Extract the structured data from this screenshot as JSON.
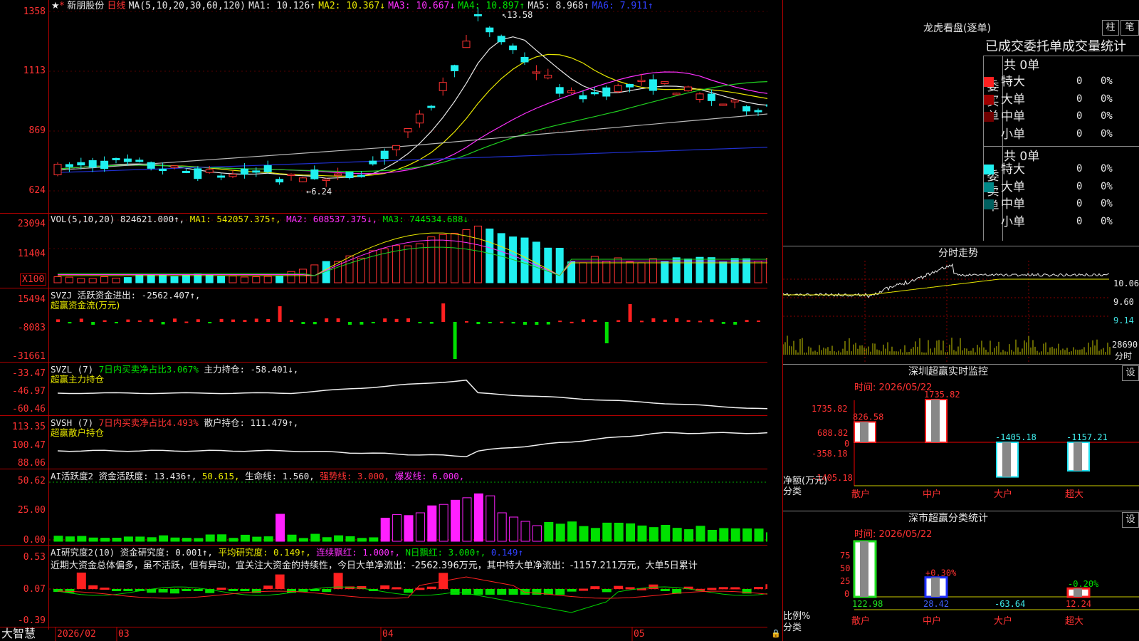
{
  "header": {
    "stock_name": "新朋股份",
    "period": "日线",
    "ma_label": "MA(5,10,20,30,60,120)",
    "ma1": "MA1: 10.126↑",
    "ma2": "MA2: 10.367↓",
    "ma3": "MA3: 10.667↓",
    "ma4": "MA4: 10.897↑",
    "ma5": "MA5: 8.968↑",
    "ma6": "MA6: 7.911↑",
    "high_mark": "13.58",
    "low_mark": "6.24"
  },
  "price_axis": [
    "1358",
    "1113",
    "869",
    "624"
  ],
  "vol": {
    "label": "VOL(5,10,20)",
    "value": "824621.000↑,",
    "ma1": "MA1: 542057.375↑,",
    "ma2": "MA2: 608537.375↓,",
    "ma3": "MA3: 744534.688↓",
    "axis": [
      "23094",
      "11404"
    ],
    "unit": "X100"
  },
  "svzj": {
    "label": "SVZJ  活跃资金进出: -2562.407↑,",
    "sub": "超赢资金流(万元)",
    "axis": [
      "15494",
      "-8083",
      "-31661"
    ]
  },
  "svzl": {
    "prefix": "SVZL (7)",
    "ratio": "7日内买卖净占比3.067%",
    "hold": "主力持仓: -58.401↓,",
    "sub": "超赢主力持仓",
    "axis": [
      "-33.47",
      "-46.97",
      "-60.46"
    ]
  },
  "svsh": {
    "prefix": "SVSH (7)",
    "ratio": "7日内买卖净占比4.493%",
    "hold": "散户持仓: 111.479↑,",
    "sub": "超赢散户持仓",
    "axis": [
      "113.35",
      "100.47",
      "88.06"
    ]
  },
  "ai_active": {
    "prefix": "AI活跃度2",
    "active": "资金活跃度: 13.436↑,",
    "v2": "50.615,",
    "life": "生命线: 1.560,",
    "strong": "强势线: 3.000,",
    "burst": "爆发线: 6.000,",
    "axis": [
      "50.62",
      "25.00",
      "0.00"
    ]
  },
  "ai_research": {
    "prefix": "AI研究度2(10)",
    "research": "资金研究度: 0.001↑,",
    "avg": "平均研究度: 0.149↑,",
    "cont": "连续飘红: 1.000↑,",
    "nday": "N日飘红: 3.000↑,",
    "last": "0.149↑",
    "comment": "近期大资金总体偏多，虽不活跃，但有异动，宜关注大资金的持续性，今日大单净流出：-2562.396万元，其中特大单净流出：-1157.211万元，大单5日累计",
    "axis": [
      "0.53",
      "0.07",
      "-0.39"
    ]
  },
  "date_axis": {
    "brand": "大智慧",
    "labels": [
      "2026/02",
      "03",
      "04",
      "05"
    ]
  },
  "dragon_tiger": {
    "title": "龙虎看盘(逐单)",
    "btn_bar": "柱",
    "btn_pen": "笔",
    "subtitle": "已成交委托单成交量统计",
    "buy_header": "共 0单",
    "buy_side": "委买单",
    "sell_header": "共 0单",
    "sell_side": "委卖单",
    "buy_rows": [
      {
        "label": "特大",
        "count": "0",
        "pct": "0%",
        "color": "#ff2020"
      },
      {
        "label": "大单",
        "count": "0",
        "pct": "0%",
        "color": "#a00000"
      },
      {
        "label": "中单",
        "count": "0",
        "pct": "0%",
        "color": "#700000"
      },
      {
        "label": "小单",
        "count": "0",
        "pct": "0%",
        "color": "#000000"
      }
    ],
    "sell_rows": [
      {
        "label": "特大",
        "count": "0",
        "pct": "0%",
        "color": "#20f0f0"
      },
      {
        "label": "大单",
        "count": "0",
        "pct": "0%",
        "color": "#008888"
      },
      {
        "label": "中单",
        "count": "0",
        "pct": "0%",
        "color": "#006060"
      },
      {
        "label": "小单",
        "count": "0",
        "pct": "0%",
        "color": "#000000"
      }
    ]
  },
  "intraday": {
    "title": "分时走势",
    "price_labels": [
      "10.06",
      "9.60",
      "9.14"
    ],
    "vol_label": "28690",
    "vol_unit": "分时"
  },
  "sz_monitor": {
    "title": "深圳超赢实时监控",
    "btn": "设",
    "time": "时间: 2026/05/22",
    "axis": [
      "1735.82",
      "688.82",
      "0",
      "-358.18",
      "-1405.18"
    ],
    "ylabel1": "净额(万元)",
    "ylabel2": "分类",
    "chart_data": {
      "type": "bar",
      "categories": [
        "散户",
        "中户",
        "大户",
        "超大"
      ],
      "values": [
        826.58,
        1735.82,
        -1405.18,
        -1157.21
      ],
      "labels": [
        "826.58",
        "1735.82",
        "-1405.18",
        "-1157.21"
      ]
    }
  },
  "sz_class": {
    "title": "深市超赢分类统计",
    "btn": "设",
    "time": "时间: 2026/05/22",
    "axis": [
      "75",
      "50",
      "25",
      "0"
    ],
    "ylabel1": "比例%",
    "ylabel2": "分类",
    "chart_data": {
      "type": "bar",
      "categories": [
        "散户",
        "中户",
        "大户",
        "超大"
      ],
      "values": [
        122.98,
        28.42,
        -63.64,
        12.24
      ],
      "changes": [
        "",
        "+0.30%",
        "",
        "-0.20%"
      ],
      "labels": [
        "122.98",
        "28.42",
        "-63.64",
        "12.24"
      ]
    }
  }
}
